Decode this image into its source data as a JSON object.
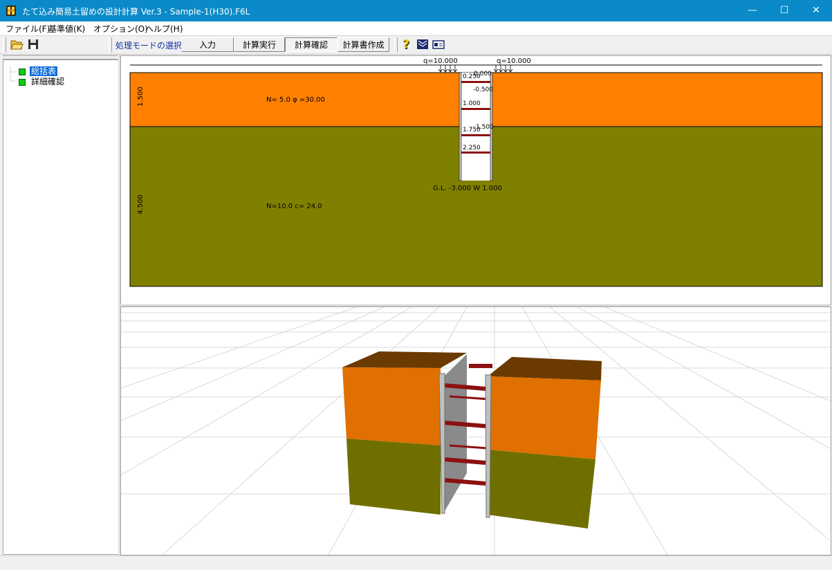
{
  "window": {
    "title": "たて込み簡易土留めの設計計算 Ver.3 - Sample-1(H30).F6L",
    "minimize": "—",
    "maximize": "☐",
    "close": "✕"
  },
  "menu": [
    {
      "label": "ファイル(F)"
    },
    {
      "label": "基準値(K)"
    },
    {
      "label": "オプション(O)"
    },
    {
      "label": "ヘルプ(H)"
    }
  ],
  "toolbar": {
    "open_icon": "folder-open-icon",
    "save_icon": "save-disk-icon",
    "mode_label": "処理モードの選択",
    "modes": [
      {
        "label": "入力",
        "active": false
      },
      {
        "label": "計算実行",
        "active": false
      },
      {
        "label": "計算確認",
        "active": true
      },
      {
        "label": "計算書作成",
        "active": false
      }
    ],
    "help_icon": "question-icon",
    "book_icon": "book-icon",
    "card_icon": "card-icon"
  },
  "tree": {
    "items": [
      {
        "label": "総括表",
        "selected": true
      },
      {
        "label": "詳細確認",
        "selected": false
      }
    ]
  },
  "section": {
    "load_left": "q=10.000",
    "load_right": "q=10.000",
    "layers": [
      {
        "thickness": "1.500",
        "label": "N= 5.0  φ =30.00",
        "color": "#ff8000"
      },
      {
        "thickness": "4.500",
        "label": "N=10.0 c=  24.0",
        "color": "#808000"
      }
    ],
    "left_depths": [
      "0.250",
      "1.000",
      "1.750",
      "2.250"
    ],
    "right_depths": [
      "0.000",
      "-0.500",
      "1.500"
    ],
    "bottom_label": "G.L. -3.000 W 1.000"
  },
  "view3d": {
    "upper_color": "#e07000",
    "lower_color": "#6f6f00",
    "top_color": "#6b3a00",
    "strut_color": "#8c1010"
  }
}
